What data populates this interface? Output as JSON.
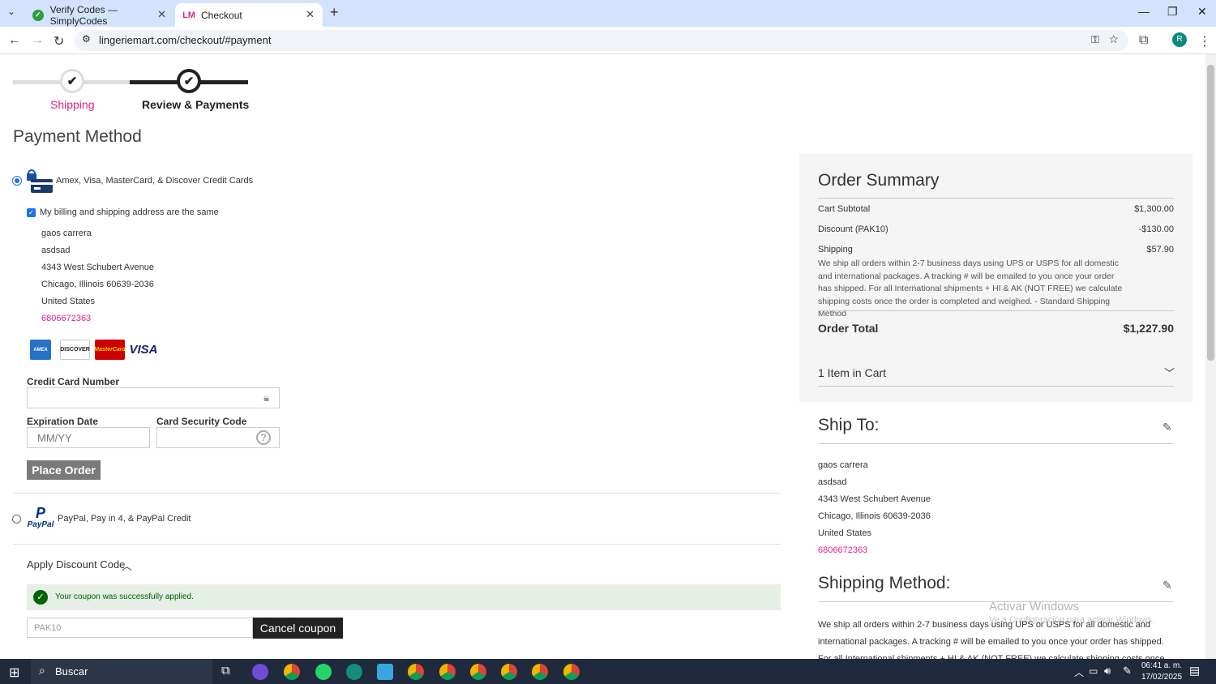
{
  "browser": {
    "tabs": [
      {
        "title": "Verify Codes — SimplyCodes",
        "active": false
      },
      {
        "title": "Checkout",
        "active": true
      }
    ],
    "url": "lingeriemart.com/checkout/#payment",
    "profile_initial": "R"
  },
  "steps": [
    {
      "label": "Shipping",
      "state": "done"
    },
    {
      "label": "Review & Payments",
      "state": "current"
    }
  ],
  "payment": {
    "title": "Payment Method",
    "credit_option_label": "Amex, Visa, MasterCard, & Discover Credit Cards",
    "same_address_label": "My billing and shipping address are the same",
    "address": [
      "gaos carrera",
      "asdsad",
      "4343 West Schubert Avenue",
      "Chicago, Illinois 60639-2036",
      "United States"
    ],
    "phone": "6806672363",
    "card_logos": [
      "AMEX",
      "DISCOVER",
      "MasterCard",
      "VISA"
    ],
    "cc_number_label": "Credit Card Number",
    "exp_label": "Expiration Date",
    "exp_placeholder": "MM/YY",
    "csc_label": "Card Security Code",
    "place_order": "Place Order",
    "paypal_label": "PayPal, Pay in 4, & PayPal Credit",
    "paypal_logo": "PayPal"
  },
  "discount": {
    "title": "Apply Discount Code",
    "success_msg": "Your coupon was successfully applied.",
    "code_value": "PAK10",
    "cancel_button": "Cancel coupon"
  },
  "summary": {
    "title": "Order Summary",
    "rows": [
      {
        "label": "Cart Subtotal",
        "value": "$1,300.00"
      },
      {
        "label": "Discount (PAK10)",
        "value": "-$130.00"
      },
      {
        "label": "Shipping",
        "value": "$57.90"
      }
    ],
    "shipping_note": "We ship all orders within 2-7 business days using UPS or USPS for all domestic and international packages. A tracking # will be emailed to you once your order has shipped. For all International shipments + HI & AK (NOT FREE) we calculate shipping costs once the order is completed and weighed. - Standard Shipping Method",
    "total_label": "Order Total",
    "total_value": "$1,227.90",
    "items_in_cart": "1 Item in Cart"
  },
  "ship_to": {
    "title": "Ship To:",
    "address": [
      "gaos carrera",
      "asdsad",
      "4343 West Schubert Avenue",
      "Chicago, Illinois 60639-2036",
      "United States"
    ],
    "phone": "6806672363"
  },
  "shipping_method": {
    "title": "Shipping Method:",
    "text": "We ship all orders within 2-7 business days using UPS or USPS for all domestic and international packages. A tracking # will be emailed to you once your order has shipped. For all International shipments + HI & AK (NOT FREE) we calculate shipping costs once the order is completed and"
  },
  "watermark": {
    "title": "Activar Windows",
    "subtitle": "Ve a Configuración para activar Windows."
  },
  "taskbar": {
    "search": "Buscar",
    "time": "06:41 a. m.",
    "date": "17/02/2025"
  },
  "colors": {
    "accent_pink": "#e0218a",
    "dark": "#222222",
    "success_bg": "#e5efe5",
    "success_text": "#006400"
  }
}
